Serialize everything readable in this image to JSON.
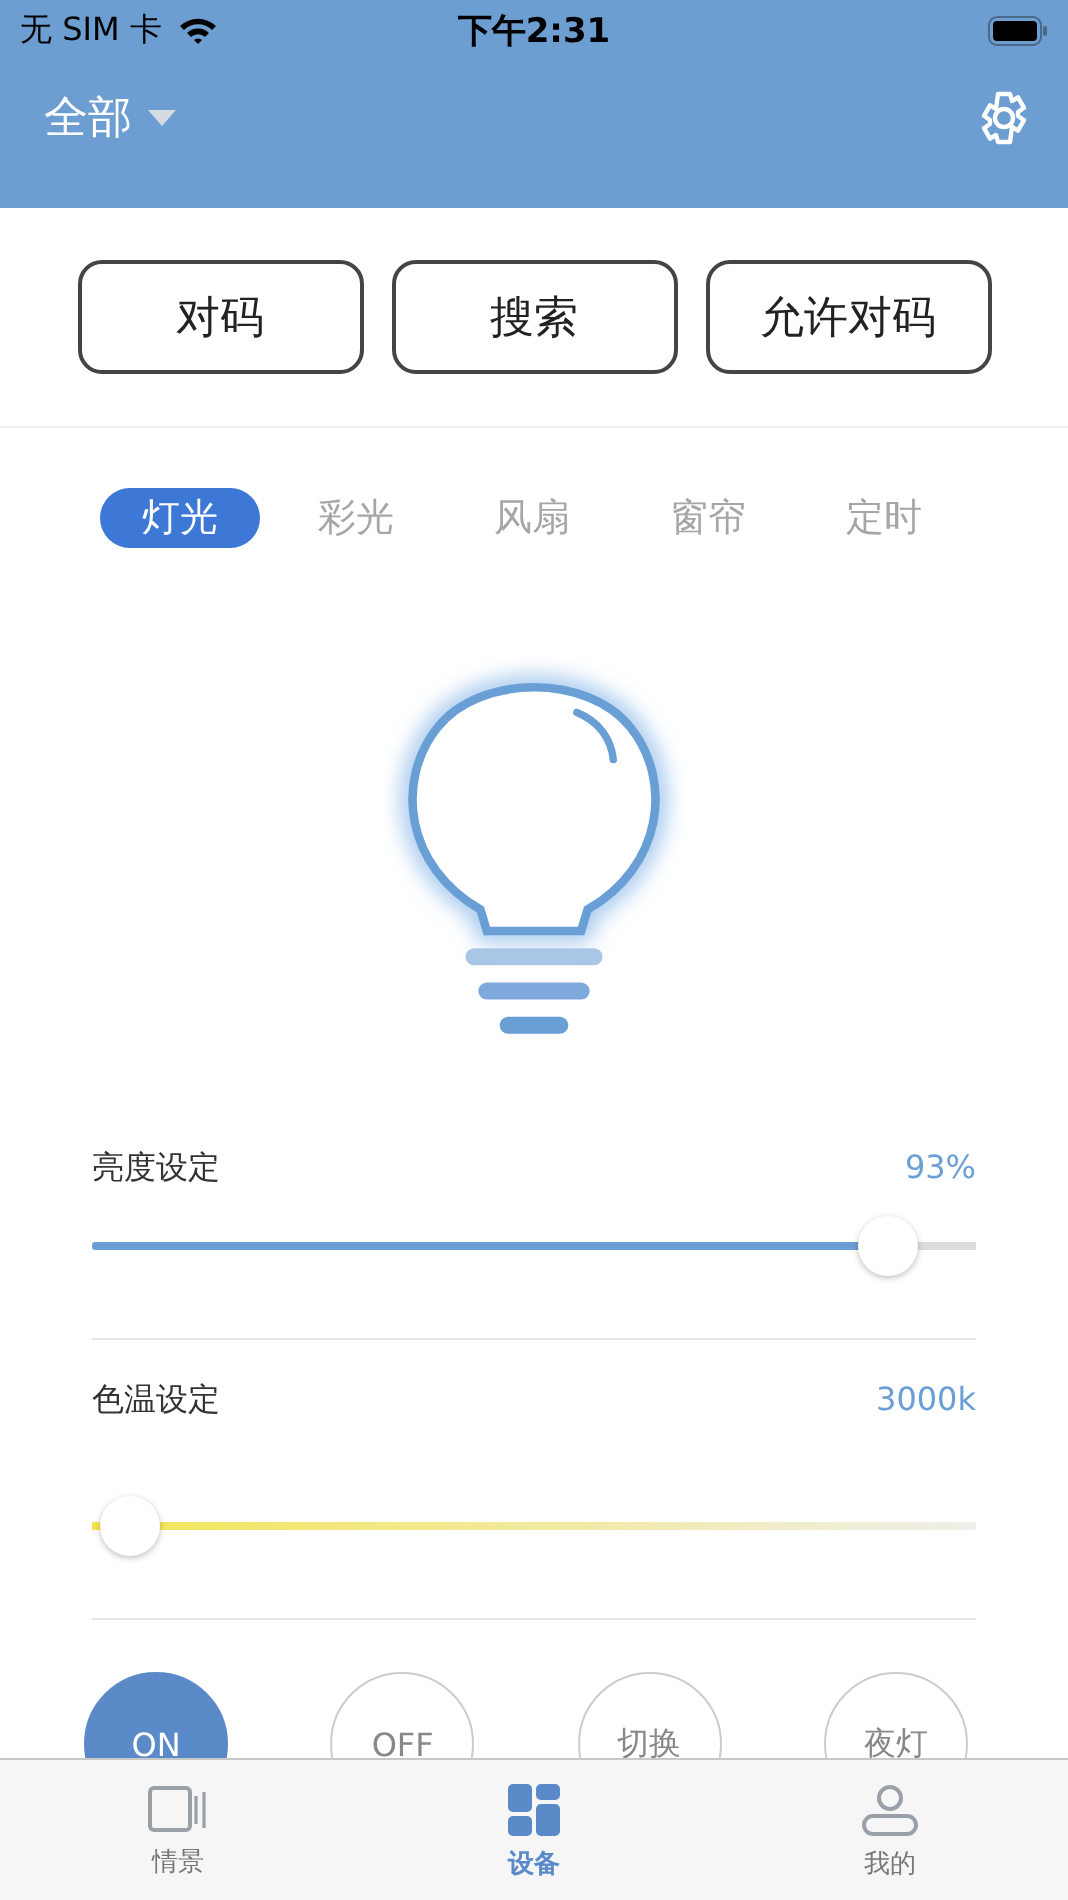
{
  "status_bar": {
    "carrier": "无 SIM 卡",
    "time": "下午2:31"
  },
  "header": {
    "scope": "全部"
  },
  "actions": [
    "对码",
    "搜索",
    "允许对码"
  ],
  "categories": [
    {
      "label": "灯光",
      "selected": true
    },
    {
      "label": "彩光",
      "selected": false
    },
    {
      "label": "风扇",
      "selected": false
    },
    {
      "label": "窗帘",
      "selected": false
    },
    {
      "label": "定时",
      "selected": false
    }
  ],
  "sliders": [
    {
      "kind": "brightness",
      "label": "亮度设定",
      "reading": "93%",
      "level": 0.93
    },
    {
      "kind": "temperature",
      "label": "色温设定",
      "reading": "3000k",
      "level": 0.01
    }
  ],
  "modes": [
    {
      "label": "ON",
      "selected": true
    },
    {
      "label": "OFF",
      "selected": false
    },
    {
      "label": "切换",
      "selected": false
    },
    {
      "label": "夜灯",
      "selected": false
    }
  ],
  "tab_bar": [
    {
      "kind": "scene",
      "label": "情景",
      "selected": false
    },
    {
      "kind": "devices",
      "label": "设备",
      "selected": true
    },
    {
      "kind": "profile",
      "label": "我的",
      "selected": false
    }
  ]
}
